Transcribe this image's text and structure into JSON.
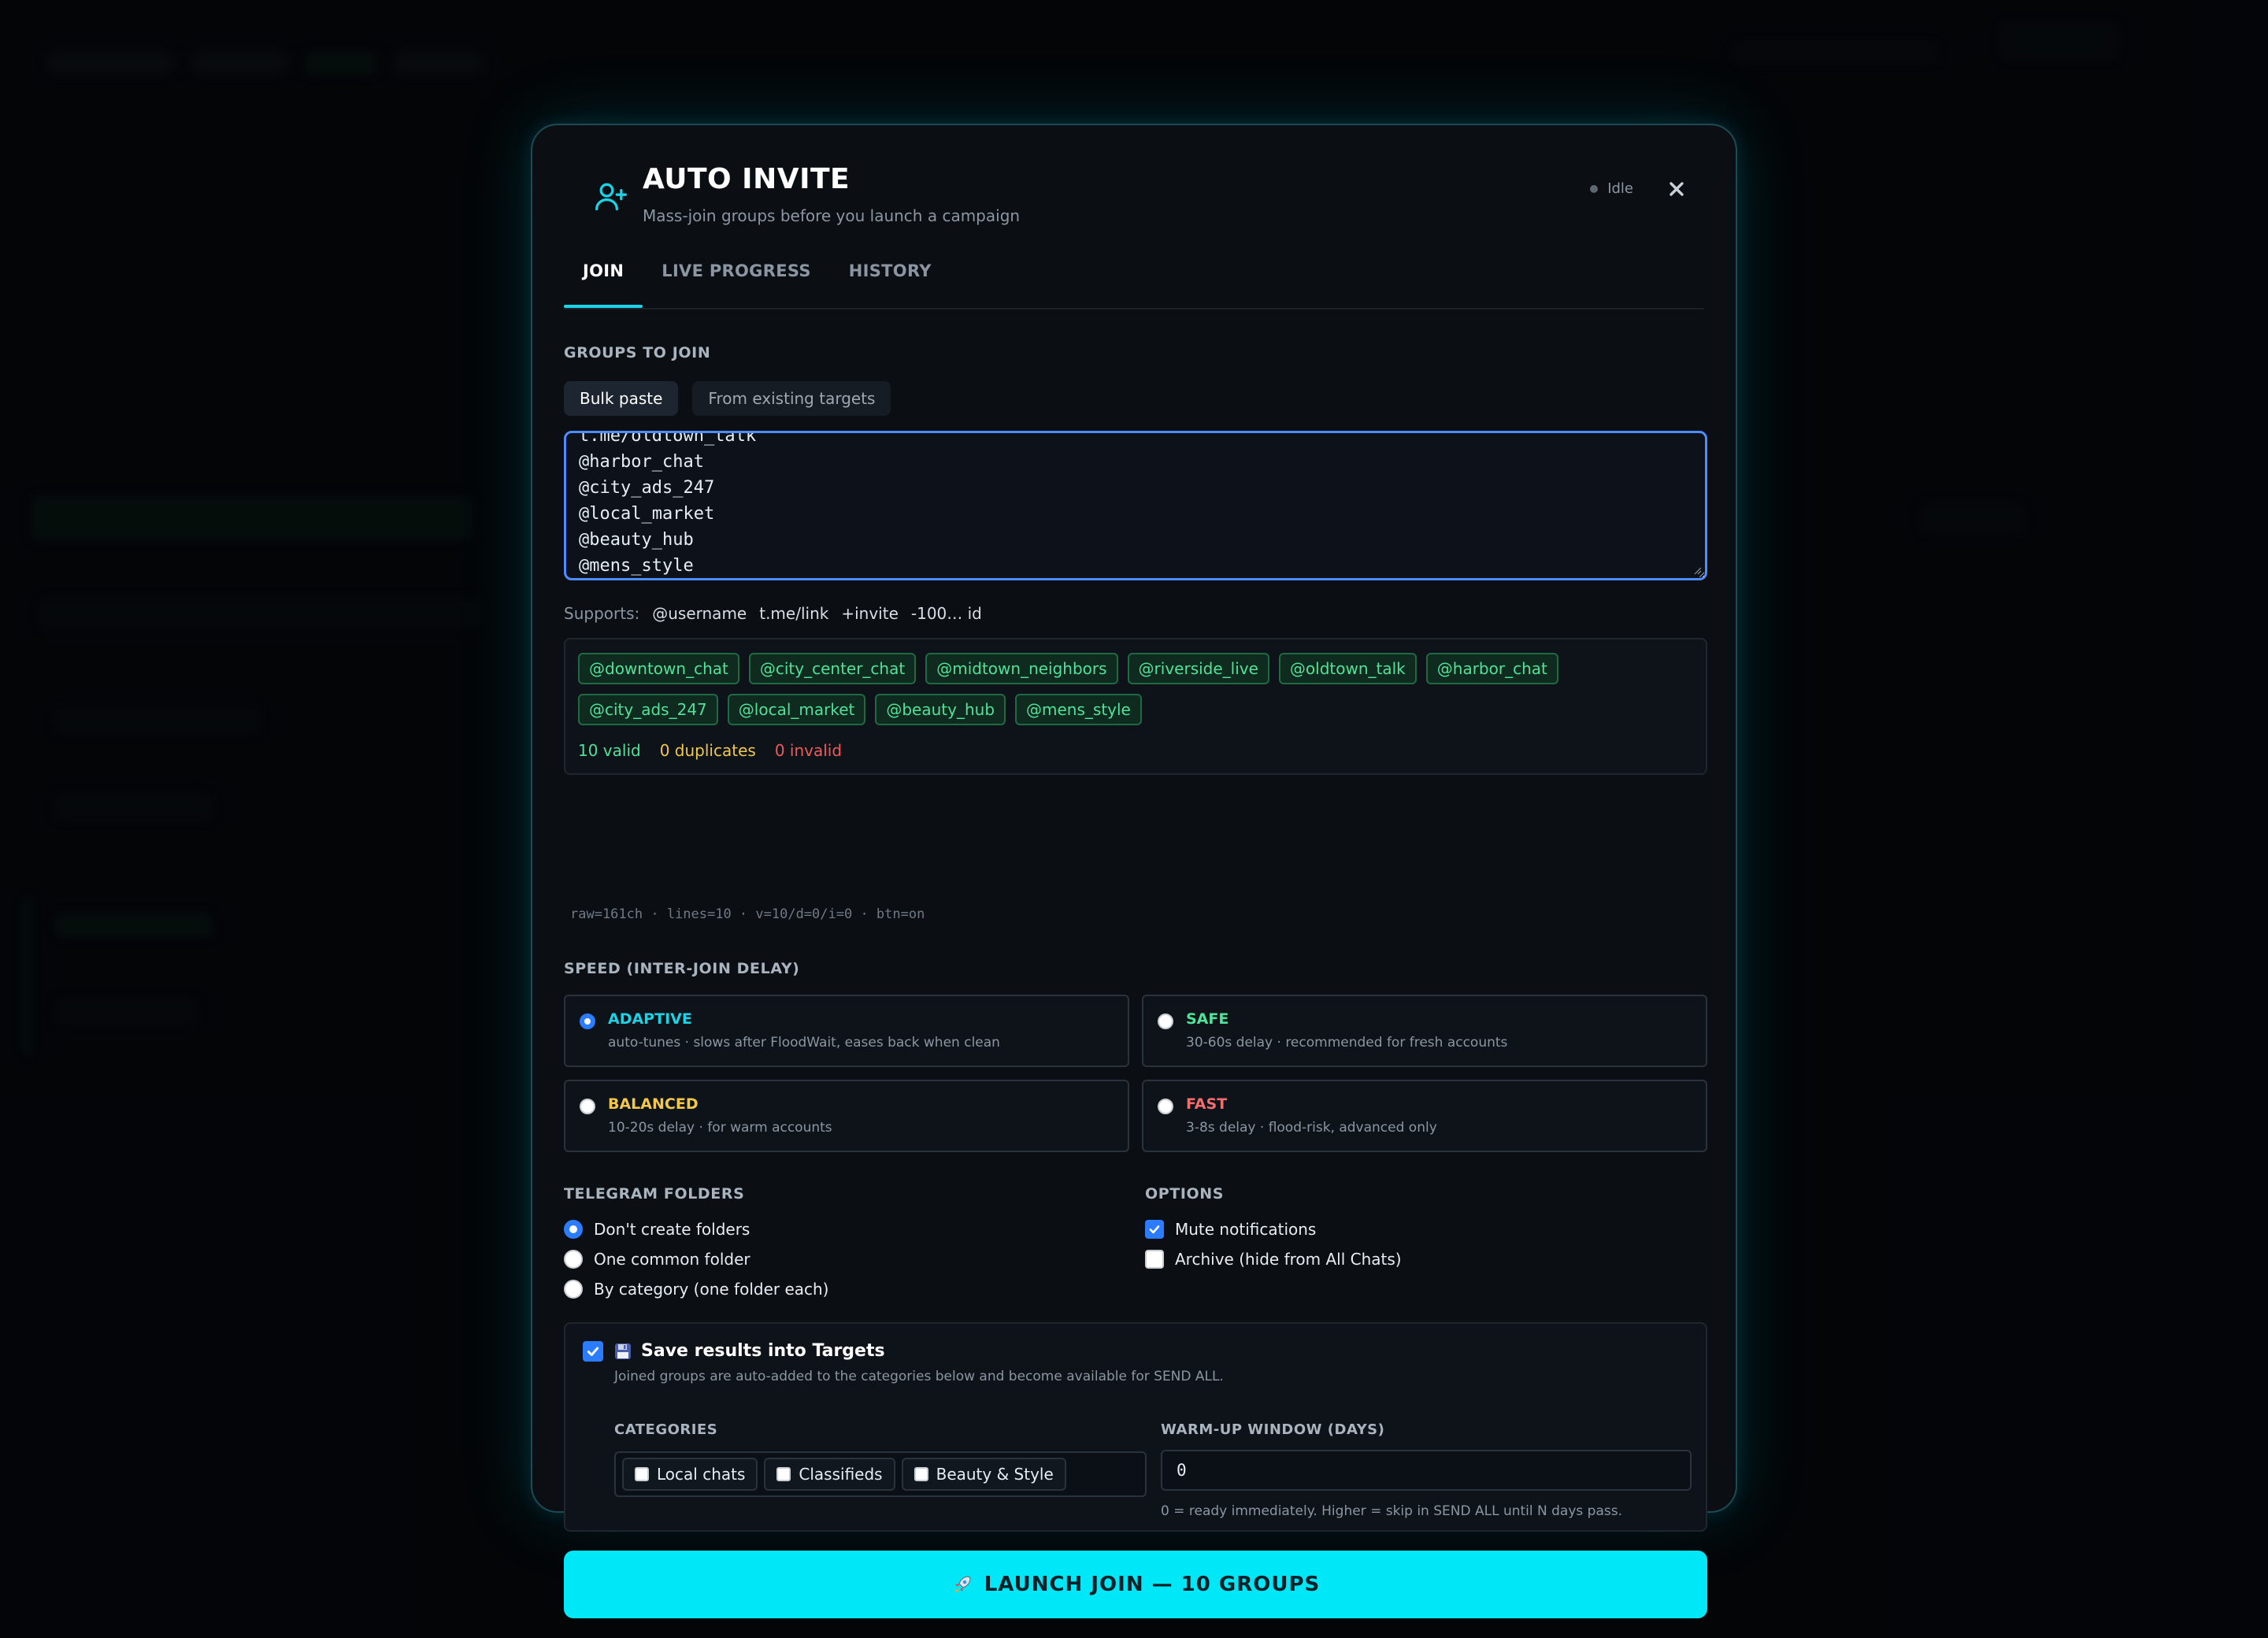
{
  "modal": {
    "title": "AUTO INVITE",
    "subtitle": "Mass-join groups before you launch a campaign",
    "status": "Idle",
    "tabs": [
      {
        "label": "JOIN",
        "active": true
      },
      {
        "label": "LIVE PROGRESS",
        "active": false
      },
      {
        "label": "HISTORY",
        "active": false
      }
    ]
  },
  "groups": {
    "label": "GROUPS TO JOIN",
    "source_tabs": [
      {
        "label": "Bulk paste",
        "active": true
      },
      {
        "label": "From existing targets",
        "active": false
      }
    ],
    "textarea_lines": [
      "t.me/oldtown_talk",
      "@harbor_chat",
      "@city_ads_247",
      "@local_market",
      "@beauty_hub",
      "@mens_style"
    ],
    "supports_label": "Supports:",
    "supports_formats": [
      "@username",
      "t.me/link",
      "+invite",
      "-100… id"
    ],
    "chips": [
      "@downtown_chat",
      "@city_center_chat",
      "@midtown_neighbors",
      "@riverside_live",
      "@oldtown_talk",
      "@harbor_chat",
      "@city_ads_247",
      "@local_market",
      "@beauty_hub",
      "@mens_style"
    ],
    "count_valid": "10 valid",
    "count_duplicates": "0 duplicates",
    "count_invalid": "0 invalid",
    "debug": "raw=161ch · lines=10 · v=10/d=0/i=0 · btn=on"
  },
  "speed": {
    "label": "SPEED (INTER-JOIN DELAY)",
    "options": [
      {
        "name": "ADAPTIVE",
        "desc": "auto-tunes · slows after FloodWait, eases back when clean",
        "selected": true,
        "color": "#19d3e6"
      },
      {
        "name": "SAFE",
        "desc": "30-60s delay · recommended for fresh accounts",
        "selected": false,
        "color": "#4fe39a"
      },
      {
        "name": "BALANCED",
        "desc": "10-20s delay · for warm accounts",
        "selected": false,
        "color": "#f3c84a"
      },
      {
        "name": "FAST",
        "desc": "3-8s delay · flood-risk, advanced only",
        "selected": false,
        "color": "#f26d6d"
      }
    ]
  },
  "folders": {
    "label": "TELEGRAM FOLDERS",
    "options": [
      {
        "label": "Don't create folders",
        "selected": true
      },
      {
        "label": "One common folder",
        "selected": false
      },
      {
        "label": "By category (one folder each)",
        "selected": false
      }
    ]
  },
  "options": {
    "label": "OPTIONS",
    "items": [
      {
        "label": "Mute notifications",
        "checked": true
      },
      {
        "label": "Archive (hide from All Chats)",
        "checked": false
      }
    ]
  },
  "save": {
    "checked": true,
    "title": "Save results into Targets",
    "desc": "Joined groups are auto-added to the categories below and become available for SEND ALL.",
    "categories_label": "CATEGORIES",
    "categories": [
      {
        "label": "Local chats",
        "checked": false
      },
      {
        "label": "Classifieds",
        "checked": false
      },
      {
        "label": "Beauty & Style",
        "checked": false
      }
    ],
    "warmup_label": "WARM-UP WINDOW (DAYS)",
    "warmup_value": "0",
    "warmup_hint": "0 = ready immediately. Higher = skip in SEND ALL until N days pass."
  },
  "launch": {
    "label": "LAUNCH JOIN — 10 GROUPS"
  },
  "colors": {
    "accent": "#00e8f7",
    "valid": "#4fe39a",
    "warning": "#f3c84a",
    "error": "#f05a5a",
    "selected": "#2b7cff"
  }
}
